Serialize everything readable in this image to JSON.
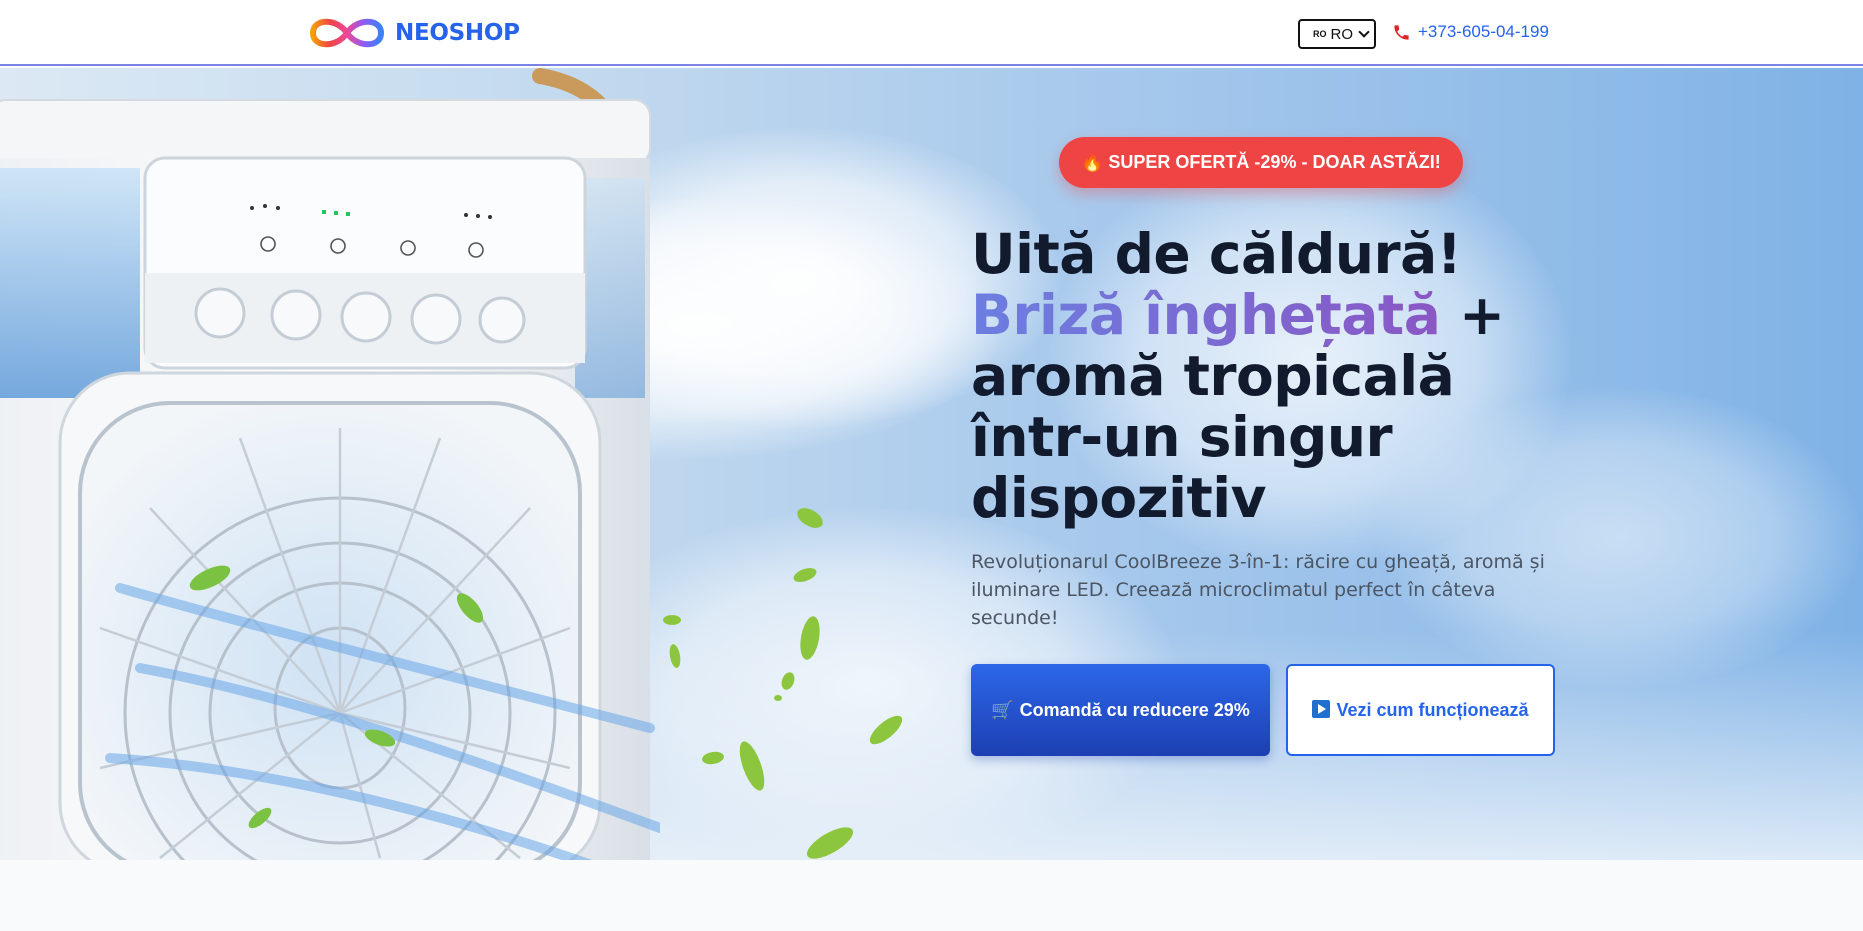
{
  "brand": {
    "name": "NEOSHOP"
  },
  "header": {
    "language": {
      "flag": "RO",
      "selected": "RO"
    },
    "phone": "+373-605-04-199"
  },
  "hero": {
    "badge": "🔥 SUPER OFERTĂ -29% - DOAR ASTĂZI!",
    "headline_line1": "Uită de căldură!",
    "headline_highlight": "Briză înghețată",
    "headline_plus": " +",
    "headline_rest": "aromă tropicală într-un singur dispozitiv",
    "description": "Revoluționarul CoolBreeze 3-în-1: răcire cu gheață, aromă și iluminare LED. Creează microclimatul perfect în câteva secunde!",
    "primary_button": {
      "icon": "🛒",
      "label": "Comandă cu reducere 29%"
    },
    "secondary_button": {
      "icon": "play-icon",
      "label": "Vezi cum funcționează"
    }
  },
  "colors": {
    "brand_blue": "#2563eb",
    "badge_red": "#ef4444",
    "headline_dark": "#121a2e",
    "gradient_start": "#6b7ee0",
    "gradient_end": "#8a57c4"
  }
}
